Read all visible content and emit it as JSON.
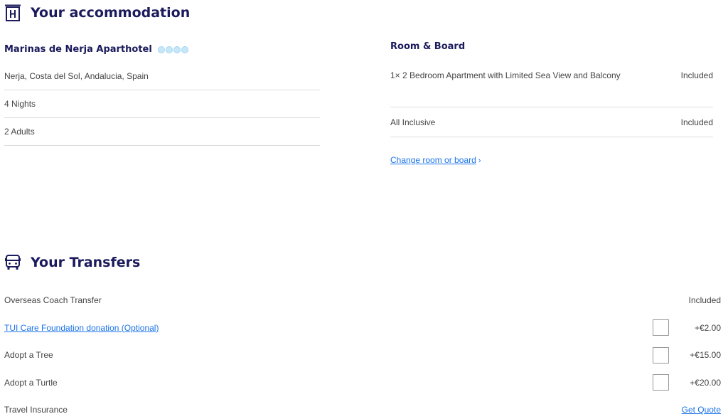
{
  "accommodation": {
    "title": "Your accommodation",
    "icon": "hotel-icon",
    "hotel_name": "Marinas de Nerja Aparthotel",
    "rating": 4,
    "details": [
      "Nerja, Costa del Sol, Andalucia, Spain",
      "4 Nights",
      "2  Adults"
    ]
  },
  "room_board": {
    "title": "Room & Board",
    "rows": [
      {
        "label": "1× 2 Bedroom Apartment with Limited Sea View and Balcony",
        "value": "Included"
      },
      {
        "label": "All Inclusive",
        "value": "Included"
      }
    ],
    "change_link": "Change room or board",
    "change_chevron": "›"
  },
  "transfers": {
    "title": "Your Transfers",
    "icon": "bus-icon",
    "rows": [
      {
        "label": "Overseas Coach Transfer",
        "value": "Included",
        "link": false,
        "checkbox": false
      },
      {
        "label": "TUI Care Foundation donation (Optional)",
        "value": "+€2.00",
        "link": true,
        "checkbox": true
      },
      {
        "label": "Adopt a Tree",
        "value": "+€15.00",
        "link": false,
        "checkbox": true
      },
      {
        "label": "Adopt a Turtle",
        "value": "+€20.00",
        "link": false,
        "checkbox": true
      },
      {
        "label": "Travel Insurance",
        "value": "Get Quote",
        "link": false,
        "checkbox": false
      }
    ]
  },
  "colors": {
    "heading": "#1a1a5c",
    "link": "#1a73e8",
    "star": "#7fc4ea"
  }
}
